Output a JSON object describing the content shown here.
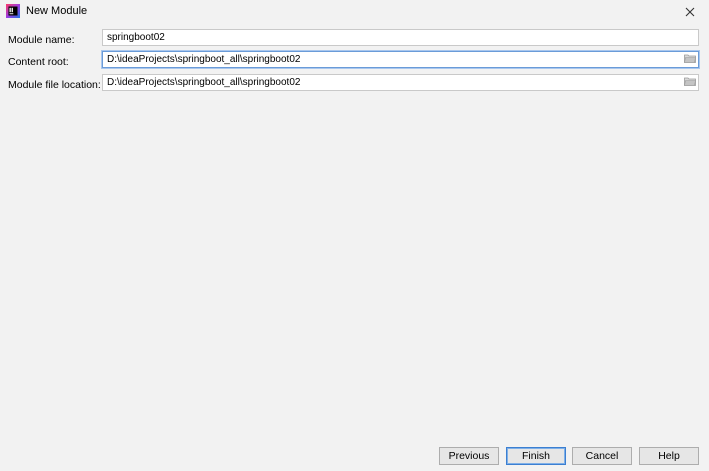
{
  "window": {
    "title": "New Module",
    "close_glyph": "✕"
  },
  "form": {
    "module_name": {
      "label": "Module name:",
      "value": "springboot02"
    },
    "content_root": {
      "label": "Content root:",
      "value": "D:\\ideaProjects\\springboot_all\\springboot02"
    },
    "module_file_location": {
      "label": "Module file location:",
      "value": "D:\\ideaProjects\\springboot_all\\springboot02"
    }
  },
  "buttons": {
    "previous": "Previous",
    "finish": "Finish",
    "cancel": "Cancel",
    "help": "Help"
  },
  "colors": {
    "background": "#f2f2f2",
    "focus_border": "#6a9bd8",
    "default_button_border": "#3c7fd1"
  },
  "icons": {
    "app": "intellij-idea-icon",
    "browse": "folder-icon",
    "close": "close-icon"
  }
}
